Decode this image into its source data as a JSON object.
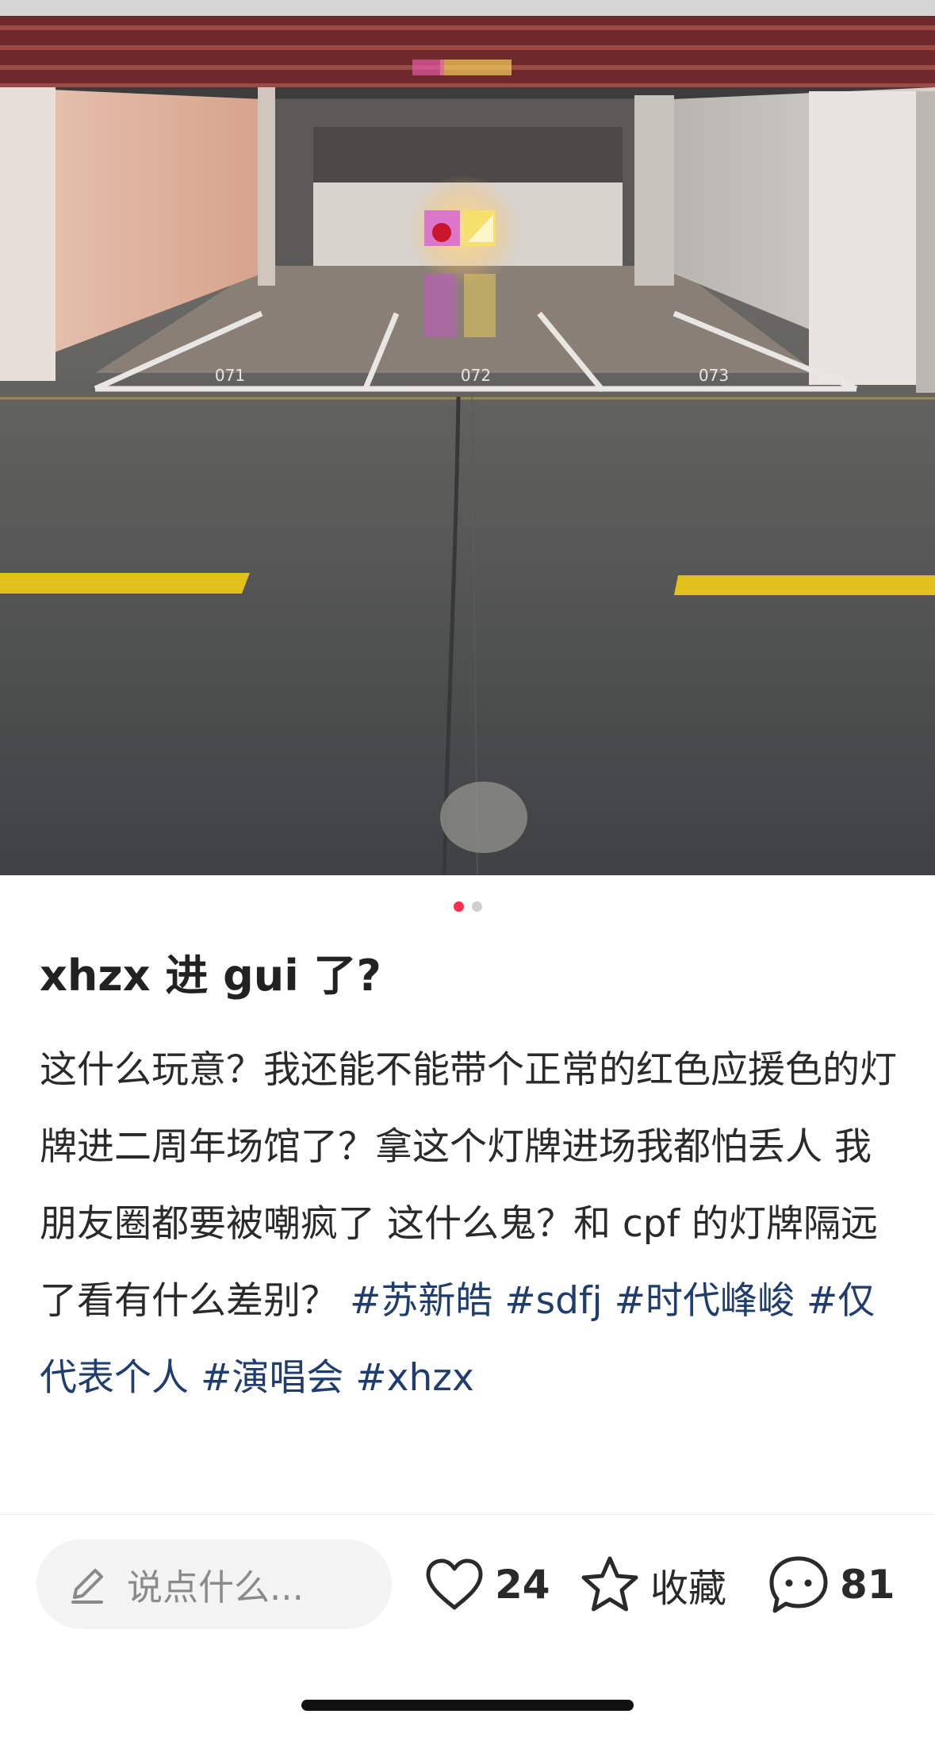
{
  "photo": {
    "alt_icon": "parking-garage-photo",
    "stall_numbers": [
      "071",
      "072",
      "073"
    ]
  },
  "carousel": {
    "total": 2,
    "active_index": 0,
    "active_color": "#ff2e4d"
  },
  "post": {
    "title": "xhzx 进 gui 了?",
    "body": "这什么玩意？我还能不能带个正常的红色应援色的灯牌进二周年场馆了？拿这个灯牌进场我都怕丢人 我朋友圈都要被嘲疯了 这什么鬼？和 cpf 的灯牌隔远了看有什么差别？",
    "tags": [
      "#苏新皓",
      "#sdfj",
      "#时代峰峻",
      "#仅代表个人",
      "#演唱会",
      "#xhzx"
    ],
    "tag_color": "#1f3e6f"
  },
  "bottom_bar": {
    "comment_placeholder": "说点什么...",
    "like_count": "24",
    "favorite_label": "收藏",
    "comment_count": "81"
  }
}
